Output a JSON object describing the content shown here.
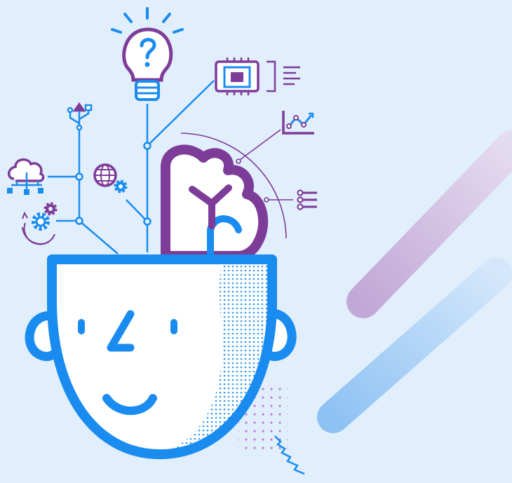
{
  "illustration": {
    "icons": [
      "lightbulb-question-icon",
      "cpu-chip-icon",
      "text-lines-icon",
      "line-chart-icon",
      "usb-icon",
      "cloud-network-icon",
      "globe-gear-icon",
      "gears-icon",
      "list-nodes-icon",
      "brain-icon",
      "smiling-face-icon"
    ]
  },
  "colors": {
    "background": "#e1eefc",
    "blue": "#1a8cf0",
    "purple": "#7d3c98",
    "face_fill": "#ffffff",
    "stripe_purple": "#c9b3dc",
    "stripe_blue": "#9fcbf4"
  }
}
